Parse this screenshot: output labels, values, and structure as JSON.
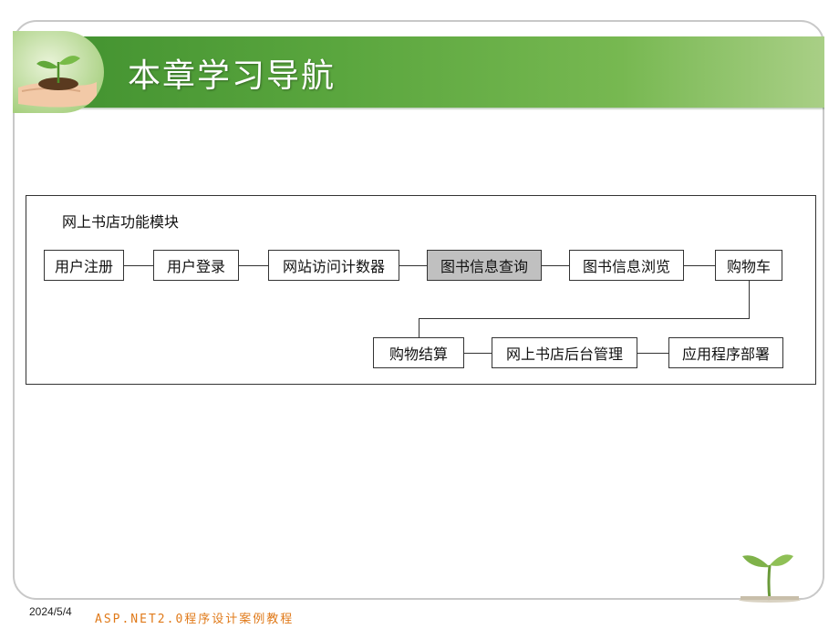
{
  "slide": {
    "title": "本章学习导航",
    "date": "2024/5/4",
    "course": "ASP.NET2.0程序设计案例教程"
  },
  "diagram": {
    "label": "网上书店功能模块",
    "row1": [
      "用户注册",
      "用户登录",
      "网站访问计数器",
      "图书信息查询",
      "图书信息浏览",
      "购物车"
    ],
    "row2": [
      "购物结算",
      "网上书店后台管理",
      "应用程序部署"
    ],
    "highlighted": "图书信息查询"
  },
  "colors": {
    "header_green": "#5aa63e",
    "highlight_gray": "#c0c0c0",
    "footer_orange": "#e07a1a"
  },
  "icons": {
    "header": "seedling-in-hands-icon",
    "footer": "sprout-icon"
  }
}
